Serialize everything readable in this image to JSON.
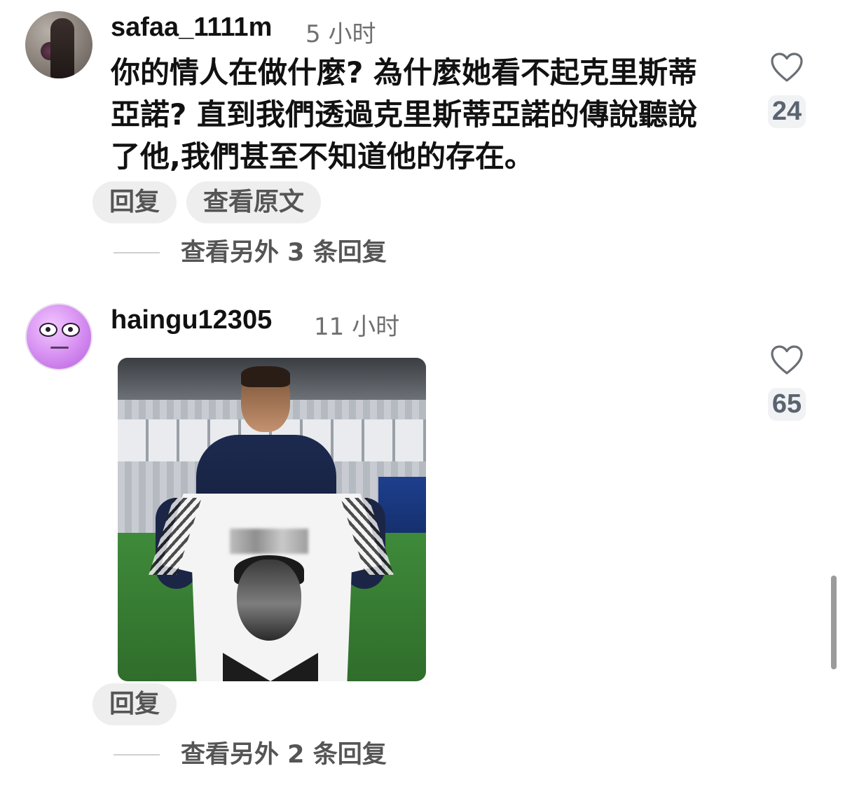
{
  "comments": [
    {
      "username": "safaa_1111m",
      "timestamp": "5 小时",
      "text": "你的情人在做什麼? 為什麼她看不起克里斯蒂亞諾? 直到我們透過克里斯蒂亞諾的傳說聽說了他,我們甚至不知道他的存在。",
      "reply_label": "回复",
      "view_original_label": "查看原文",
      "more_replies_label": "查看另外 3 条回复",
      "likes": "24",
      "avatar_icon": "profile-photo"
    },
    {
      "username": "haingu12305",
      "timestamp": "11 小时",
      "reply_label": "回复",
      "more_replies_label": "查看另外 2 条回复",
      "likes": "65",
      "avatar_icon": "purple-face-emoji",
      "attached_image": "photo-football-player-holding-jersey"
    }
  ],
  "colors": {
    "text_primary": "#111111",
    "text_secondary": "#707070",
    "pill_bg": "#eeeeef",
    "like_count": "#5a6470"
  },
  "icons": {
    "like": "heart-outline-icon"
  }
}
